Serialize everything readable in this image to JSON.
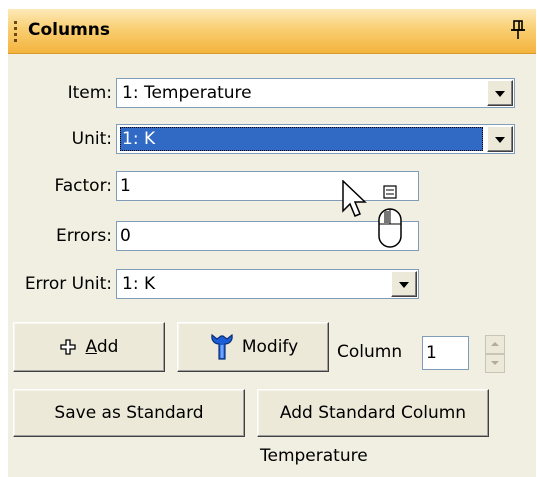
{
  "panel": {
    "title": "Columns"
  },
  "form": {
    "item": {
      "label": "Item:",
      "value": "1: Temperature"
    },
    "unit": {
      "label": "Unit:",
      "value": "1: K"
    },
    "factor": {
      "label": "Factor:",
      "value": "1"
    },
    "errors": {
      "label": "Errors:",
      "value": "0"
    },
    "error_unit": {
      "label": "Error Unit:",
      "value": "1: K"
    }
  },
  "buttons": {
    "add_label_underlined": "A",
    "add_label_rest": "dd",
    "modify_label": "Modify",
    "save_standard_label": "Save as Standard",
    "add_standard_label": "Add Standard Column"
  },
  "column": {
    "label": "Column",
    "value": "1"
  },
  "status_text": "Temperature",
  "icons": [
    "pin-icon",
    "grip-icon",
    "plus-icon",
    "wrench-icon",
    "cursor-icon",
    "mouse-icon"
  ],
  "colors": {
    "title_gradient_top": "#fde9b8",
    "title_gradient_bottom": "#f4b33e",
    "selection": "#316ac5",
    "panel_bg": "#f1efe2"
  }
}
